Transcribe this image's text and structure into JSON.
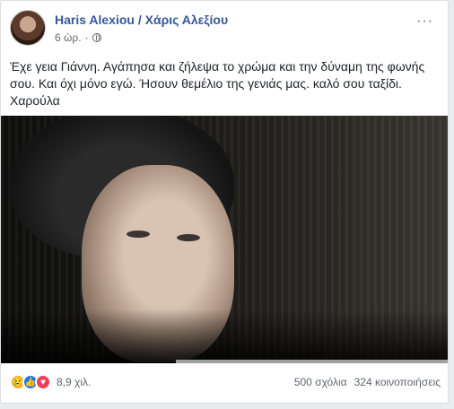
{
  "post": {
    "author": "Haris Alexiou / Χάρις Αλεξίου",
    "time": "6 ώρ.",
    "more_icon": "···",
    "text_lines": [
      "Έχε γεια Γιάννη. Αγάπησα και ζήλεψα το χρώμα και την δύναμη της φωνής",
      "σου. Και όχι μόνο εγώ. Ήσουν θεμέλιο της γενιάς μας. καλό σου ταξίδι.",
      "Χαρούλα"
    ]
  },
  "footer": {
    "reaction_icons": {
      "sad": "😢",
      "like": "👍",
      "love": "♥"
    },
    "reaction_count": "8,9 χιλ.",
    "comments": "500 σχόλια",
    "shares": "324 κοινοποιήσεις"
  }
}
